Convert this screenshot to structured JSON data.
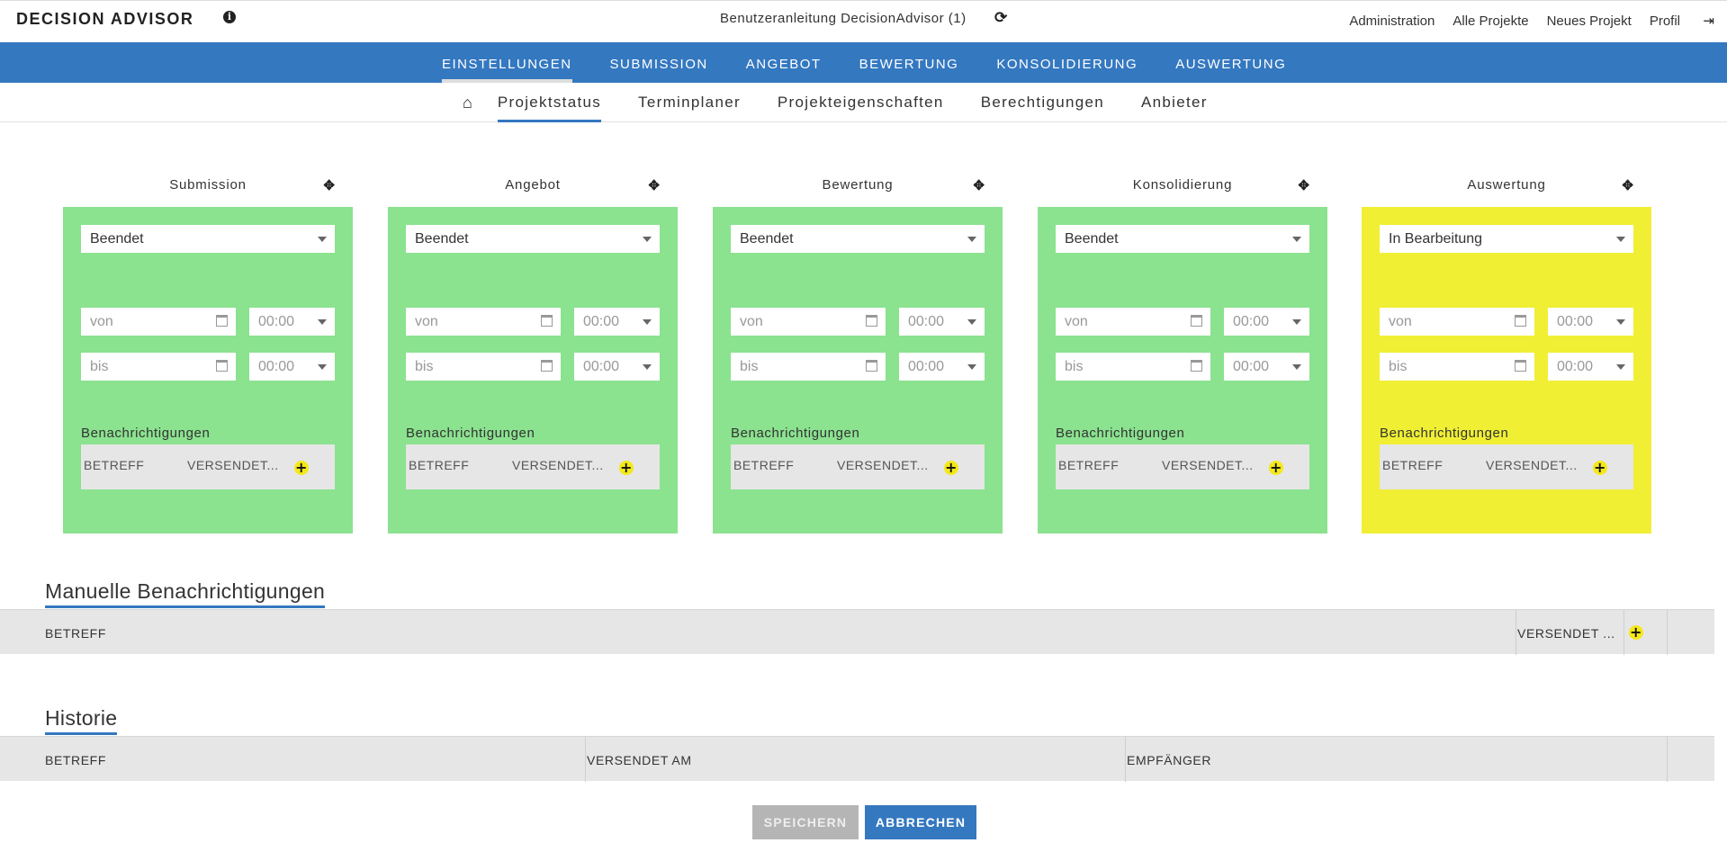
{
  "app": {
    "brand": "DECISION ADVISOR",
    "project_title": "Benutzeranleitung DecisionAdvisor (1)",
    "top_links": [
      "Administration",
      "Alle Projekte",
      "Neues Projekt",
      "Profil"
    ]
  },
  "main_nav": [
    "EINSTELLUNGEN",
    "SUBMISSION",
    "ANGEBOT",
    "BEWERTUNG",
    "KONSOLIDIERUNG",
    "AUSWERTUNG"
  ],
  "main_nav_active": "EINSTELLUNGEN",
  "sub_nav": [
    "Projektstatus",
    "Terminplaner",
    "Projekteigenschaften",
    "Berechtigungen",
    "Anbieter"
  ],
  "sub_nav_active": "Projektstatus",
  "phases": [
    {
      "title": "Submission",
      "status": "Beendet",
      "color": "#8be28f",
      "von": "von",
      "bis": "bis",
      "time_von": "00:00",
      "time_bis": "00:00",
      "notif_label": "Benachrichtigungen",
      "col_betreff": "BETREFF",
      "col_versendet": "VERSENDET..."
    },
    {
      "title": "Angebot",
      "status": "Beendet",
      "color": "#8be28f",
      "von": "von",
      "bis": "bis",
      "time_von": "00:00",
      "time_bis": "00:00",
      "notif_label": "Benachrichtigungen",
      "col_betreff": "BETREFF",
      "col_versendet": "VERSENDET..."
    },
    {
      "title": "Bewertung",
      "status": "Beendet",
      "color": "#8be28f",
      "von": "von",
      "bis": "bis",
      "time_von": "00:00",
      "time_bis": "00:00",
      "notif_label": "Benachrichtigungen",
      "col_betreff": "BETREFF",
      "col_versendet": "VERSENDET..."
    },
    {
      "title": "Konsolidierung",
      "status": "Beendet",
      "color": "#8be28f",
      "von": "von",
      "bis": "bis",
      "time_von": "00:00",
      "time_bis": "00:00",
      "notif_label": "Benachrichtigungen",
      "col_betreff": "BETREFF",
      "col_versendet": "VERSENDET..."
    },
    {
      "title": "Auswertung",
      "status": "In Bearbeitung",
      "color": "#f0ef34",
      "von": "von",
      "bis": "bis",
      "time_von": "00:00",
      "time_bis": "00:00",
      "notif_label": "Benachrichtigungen",
      "col_betreff": "BETREFF",
      "col_versendet": "VERSENDET..."
    }
  ],
  "manual": {
    "title": "Manuelle Benachrichtigungen",
    "col_betreff": "BETREFF",
    "col_versendet": "VERSENDET ..."
  },
  "history": {
    "title": "Historie",
    "col_betreff": "BETREFF",
    "col_versendet": "VERSENDET AM",
    "col_empfaenger": "EMPFÄNGER"
  },
  "buttons": {
    "save": "SPEICHERN",
    "cancel": "ABBRECHEN"
  },
  "icons": {
    "info": "info-icon",
    "refresh": "refresh-icon",
    "logout": "logout-icon",
    "home": "home-icon",
    "move": "move-icon",
    "calendar": "calendar-icon",
    "plus": "plus-icon"
  }
}
